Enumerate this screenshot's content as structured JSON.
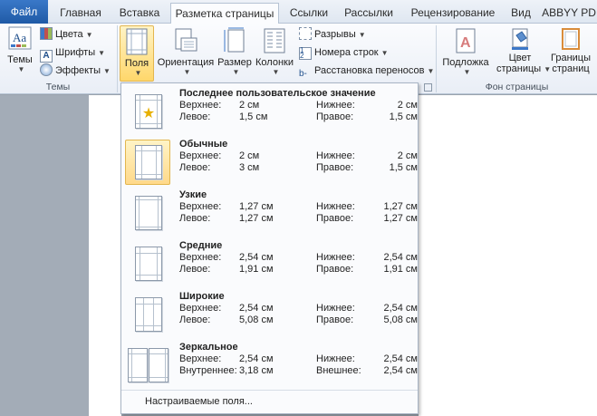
{
  "tabs": [
    {
      "label": "Файл"
    },
    {
      "label": "Главная"
    },
    {
      "label": "Вставка"
    },
    {
      "label": "Разметка страницы"
    },
    {
      "label": "Ссылки"
    },
    {
      "label": "Рассылки"
    },
    {
      "label": "Рецензирование"
    },
    {
      "label": "Вид"
    },
    {
      "label": "ABBYY PD"
    }
  ],
  "ribbon": {
    "themes": {
      "themes_label": "Темы",
      "colors_label": "Цвета",
      "fonts_label": "Шрифты",
      "effects_label": "Эффекты",
      "group_label": "Темы"
    },
    "page_setup": {
      "margins_label": "Поля",
      "orientation_label": "Ориентация",
      "size_label": "Размер",
      "columns_label": "Колонки",
      "breaks_label": "Разрывы",
      "line_numbers_label": "Номера строк",
      "hyphenation_label": "Расстановка переносов"
    },
    "page_background": {
      "watermark_label": "Подложка",
      "page_color_label_1": "Цвет",
      "page_color_label_2": "страницы",
      "page_borders_label_1": "Границы",
      "page_borders_label_2": "страниц",
      "group_label": "Фон страницы"
    }
  },
  "margins_menu": {
    "presets": [
      {
        "name": "Последнее пользовательское значение",
        "top_label": "Верхнее:",
        "top": "2 см",
        "bottom_label": "Нижнее:",
        "bottom": "2 см",
        "left_label": "Левое:",
        "left": "1,5 см",
        "right_label": "Правое:",
        "right": "1,5 см"
      },
      {
        "name": "Обычные",
        "top_label": "Верхнее:",
        "top": "2 см",
        "bottom_label": "Нижнее:",
        "bottom": "2 см",
        "left_label": "Левое:",
        "left": "3 см",
        "right_label": "Правое:",
        "right": "1,5 см"
      },
      {
        "name": "Узкие",
        "top_label": "Верхнее:",
        "top": "1,27 см",
        "bottom_label": "Нижнее:",
        "bottom": "1,27 см",
        "left_label": "Левое:",
        "left": "1,27 см",
        "right_label": "Правое:",
        "right": "1,27 см"
      },
      {
        "name": "Средние",
        "top_label": "Верхнее:",
        "top": "2,54 см",
        "bottom_label": "Нижнее:",
        "bottom": "2,54 см",
        "left_label": "Левое:",
        "left": "1,91 см",
        "right_label": "Правое:",
        "right": "1,91 см"
      },
      {
        "name": "Широкие",
        "top_label": "Верхнее:",
        "top": "2,54 см",
        "bottom_label": "Нижнее:",
        "bottom": "2,54 см",
        "left_label": "Левое:",
        "left": "5,08 см",
        "right_label": "Правое:",
        "right": "5,08 см"
      },
      {
        "name": "Зеркальное",
        "top_label": "Верхнее:",
        "top": "2,54 см",
        "bottom_label": "Нижнее:",
        "bottom": "2,54 см",
        "left_label": "Внутреннее:",
        "left": "3,18 см",
        "right_label": "Внешнее:",
        "right": "2,54 см"
      }
    ],
    "custom_label": "Настраиваемые поля..."
  },
  "colors": {
    "file_tab": "#2a67b8",
    "selection": "#ffd76b"
  }
}
